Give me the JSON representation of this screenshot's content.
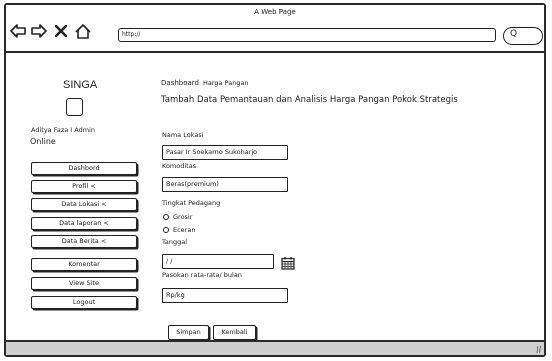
{
  "window": {
    "title": "A Web Page"
  },
  "browser": {
    "url": "http://",
    "search_glyph": "Q"
  },
  "icons": {
    "back": "back-arrow-icon",
    "forward": "forward-arrow-icon",
    "close": "close-icon",
    "home": "home-icon",
    "search": "search-icon",
    "calendar": "calendar-icon"
  },
  "sidebar": {
    "brand": "SINGA",
    "admin_name": "Aditya Faza I Admin",
    "admin_status": "Online",
    "items": [
      {
        "label": "Dashbord"
      },
      {
        "label": "Profil <"
      },
      {
        "label": "Data Lokasi <"
      },
      {
        "label": "Data laporan <"
      },
      {
        "label": "Data Berita <"
      },
      {
        "label": "Komentar"
      },
      {
        "label": "View Site"
      },
      {
        "label": "Logout"
      }
    ]
  },
  "main": {
    "breadcrumb": {
      "root": "Dashboard",
      "current": "Harga Pangan"
    },
    "title": "Tambah Data Pemantauan dan Analisis Harga Pangan Pokok Strategis",
    "form": {
      "lokasi_label": "Nama Lokasi",
      "lokasi_value": "Pasar Ir Soekarno Sukoharjo",
      "komoditas_label": "Komoditas",
      "komoditas_value": "Beras(premium)",
      "pedagang_label": "Tingkat Pedagang",
      "pedagang_options": [
        "Grosir",
        "Eceran"
      ],
      "tanggal_label": "Tanggal",
      "tanggal_value": "/ /",
      "pasokan_label": "Pasokan rata-rata/ bulan",
      "pasokan_value": "Rp/kg"
    },
    "buttons": {
      "save": "Simpan",
      "back": "Kembali"
    }
  }
}
